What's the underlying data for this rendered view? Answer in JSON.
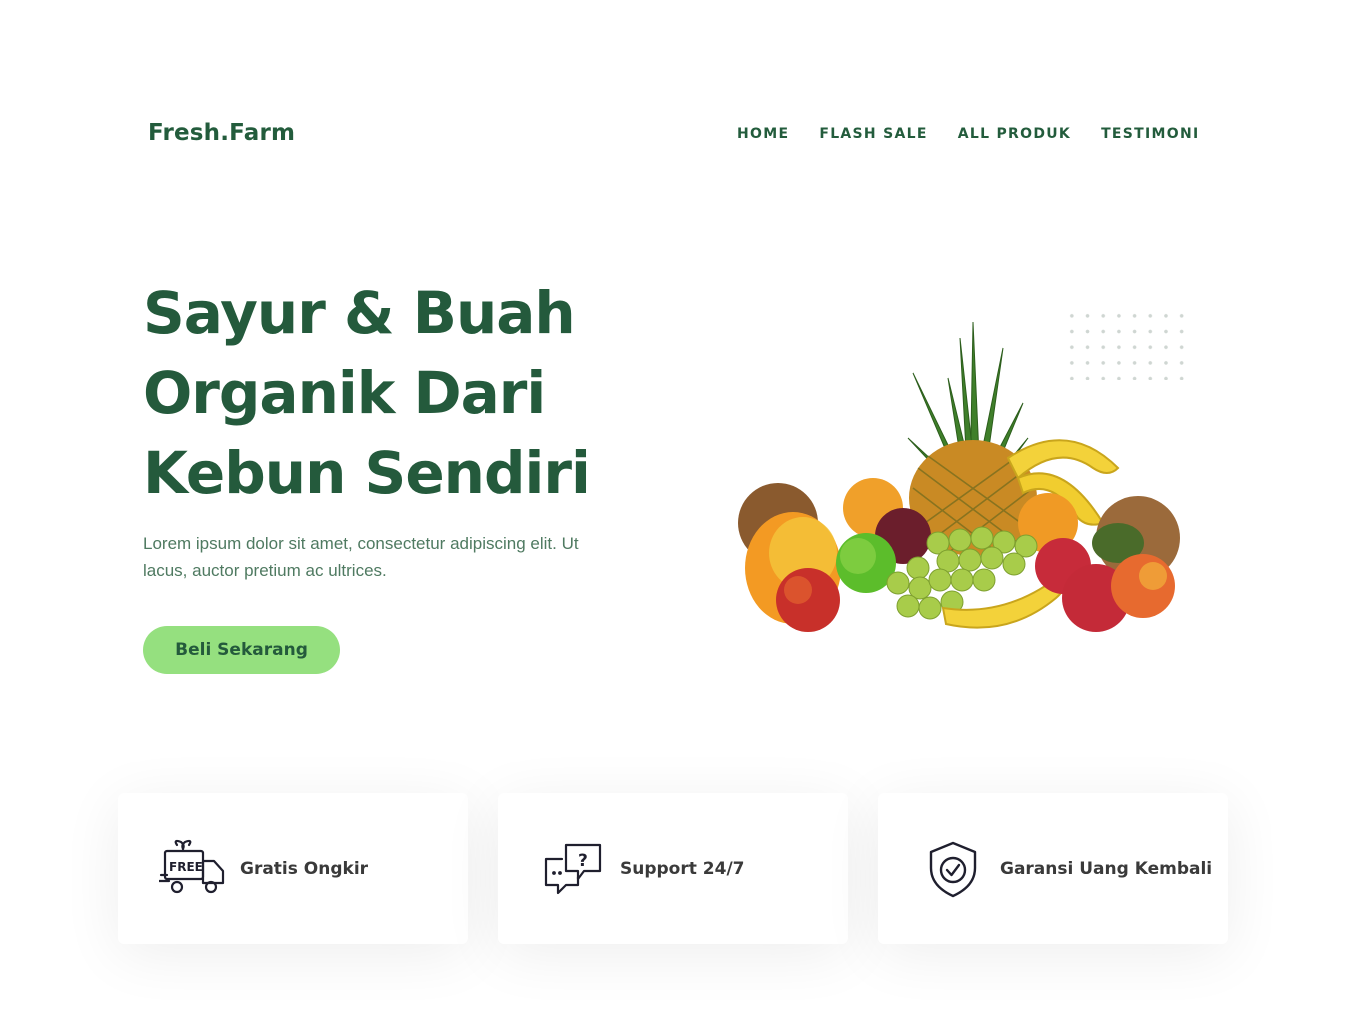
{
  "brand": {
    "logo_text": "Fresh.Farm"
  },
  "nav": {
    "items": [
      {
        "label": "HOME"
      },
      {
        "label": "FLASH SALE"
      },
      {
        "label": "ALL PRODUK"
      },
      {
        "label": "TESTIMONI"
      }
    ]
  },
  "hero": {
    "title_lines": [
      "Sayur & Buah",
      "Organik Dari",
      "Kebun Sendiri"
    ],
    "description": "Lorem ipsum dolor sit amet, consectetur adipiscing elit. Ut lacus, auctor pretium ac ultrices.",
    "cta_label": "Beli Sekarang",
    "image_icon": "fruit-pile-image"
  },
  "features": [
    {
      "label": "Gratis Ongkir",
      "icon": "free-delivery-truck-icon"
    },
    {
      "label": "Support 24/7",
      "icon": "support-chat-icon"
    },
    {
      "label": "Garansi Uang Kembali",
      "icon": "shield-check-icon"
    }
  ],
  "colors": {
    "primary": "#235c3c",
    "accent": "#95e07f",
    "text_muted": "#4f7a61",
    "feature_text": "#3a3a3a"
  }
}
